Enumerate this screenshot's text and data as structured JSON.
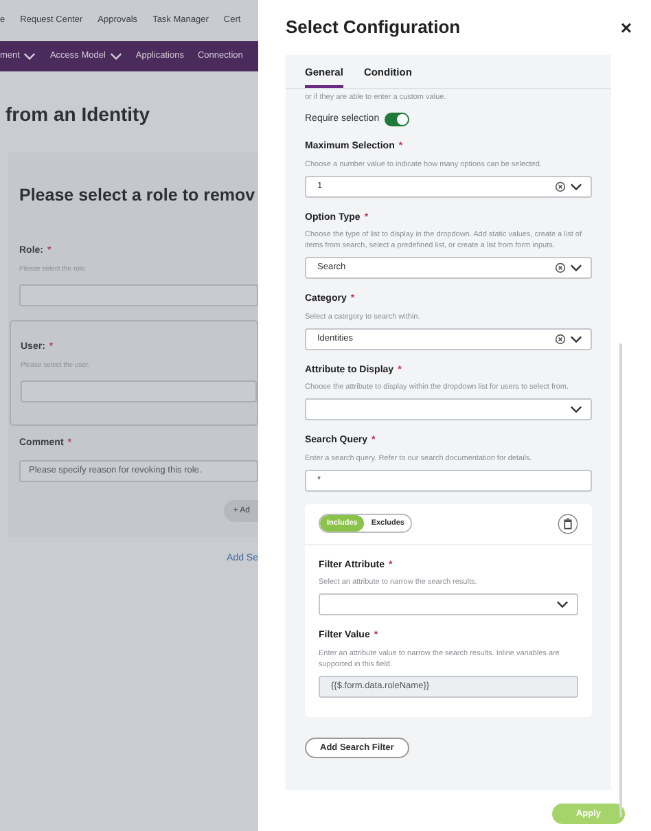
{
  "background": {
    "top_nav": [
      "e",
      "Request Center",
      "Approvals",
      "Task Manager",
      "Cert"
    ],
    "sub_nav": [
      {
        "label": "ment",
        "dropdown": true
      },
      {
        "label": "Access Model",
        "dropdown": true
      },
      {
        "label": "Applications",
        "dropdown": false
      },
      {
        "label": "Connection",
        "dropdown": false
      }
    ],
    "page_title": "from an Identity",
    "form_title": "Please select a role to remov",
    "fields": [
      {
        "label": "Role:",
        "required": true,
        "description": "Please select the role.",
        "highlighted": false
      },
      {
        "label": "User:",
        "required": true,
        "description": "Please select the user.",
        "highlighted": true
      },
      {
        "label": "Comment",
        "required": true,
        "placeholder": "Please specify reason for revoking this role.",
        "highlighted": false
      }
    ],
    "add_button": "+ Ad",
    "add_link": "Add Se"
  },
  "panel": {
    "title": "Select Configuration",
    "close": "×",
    "tabs": [
      {
        "label": "General",
        "selected": true
      },
      {
        "label": "Condition",
        "selected": false
      }
    ],
    "intro": "or if they are able to enter a custom value.",
    "require_selection": {
      "label": "Require selection",
      "on": true
    },
    "fields": [
      {
        "label": "Maximum Selection",
        "required": true,
        "description": "Choose a number value to indicate how many options can be selected.",
        "kind": "select",
        "value": "1"
      },
      {
        "label": "Option Type",
        "required": true,
        "description": "Choose the type of list to display in the dropdown. Add static values, create a list of items from search, select a predefined list, or create a list from form inputs.",
        "kind": "select",
        "value": "Search"
      },
      {
        "label": "Category",
        "required": true,
        "description": "Select a category to search within.",
        "kind": "select",
        "value": "Identities"
      },
      {
        "label": "Attribute to Display",
        "required": true,
        "description": "Choose the attribute to display within the dropdown list for users to select from.",
        "kind": "select"
      },
      {
        "label": "Search Query",
        "required": true,
        "description": "Enter a search query. Refer to our search documentation for details.",
        "kind": "input",
        "value": "*"
      }
    ],
    "filter": {
      "modes": [
        {
          "label": "Includes",
          "selected": true
        },
        {
          "label": "Excludes",
          "selected": false
        }
      ],
      "fields": [
        {
          "label": "Filter Attribute",
          "required": true,
          "description": "Select an attribute to narrow the search results.",
          "kind": "select"
        },
        {
          "label": "Filter Value",
          "required": true,
          "description": "Enter an attribute value to narrow the search results. Inline variables are supported in this field.",
          "kind": "readonly",
          "value": "{{$.form.data.roleName}}"
        }
      ]
    },
    "add_filter": "Add Search Filter",
    "apply": "Apply"
  }
}
